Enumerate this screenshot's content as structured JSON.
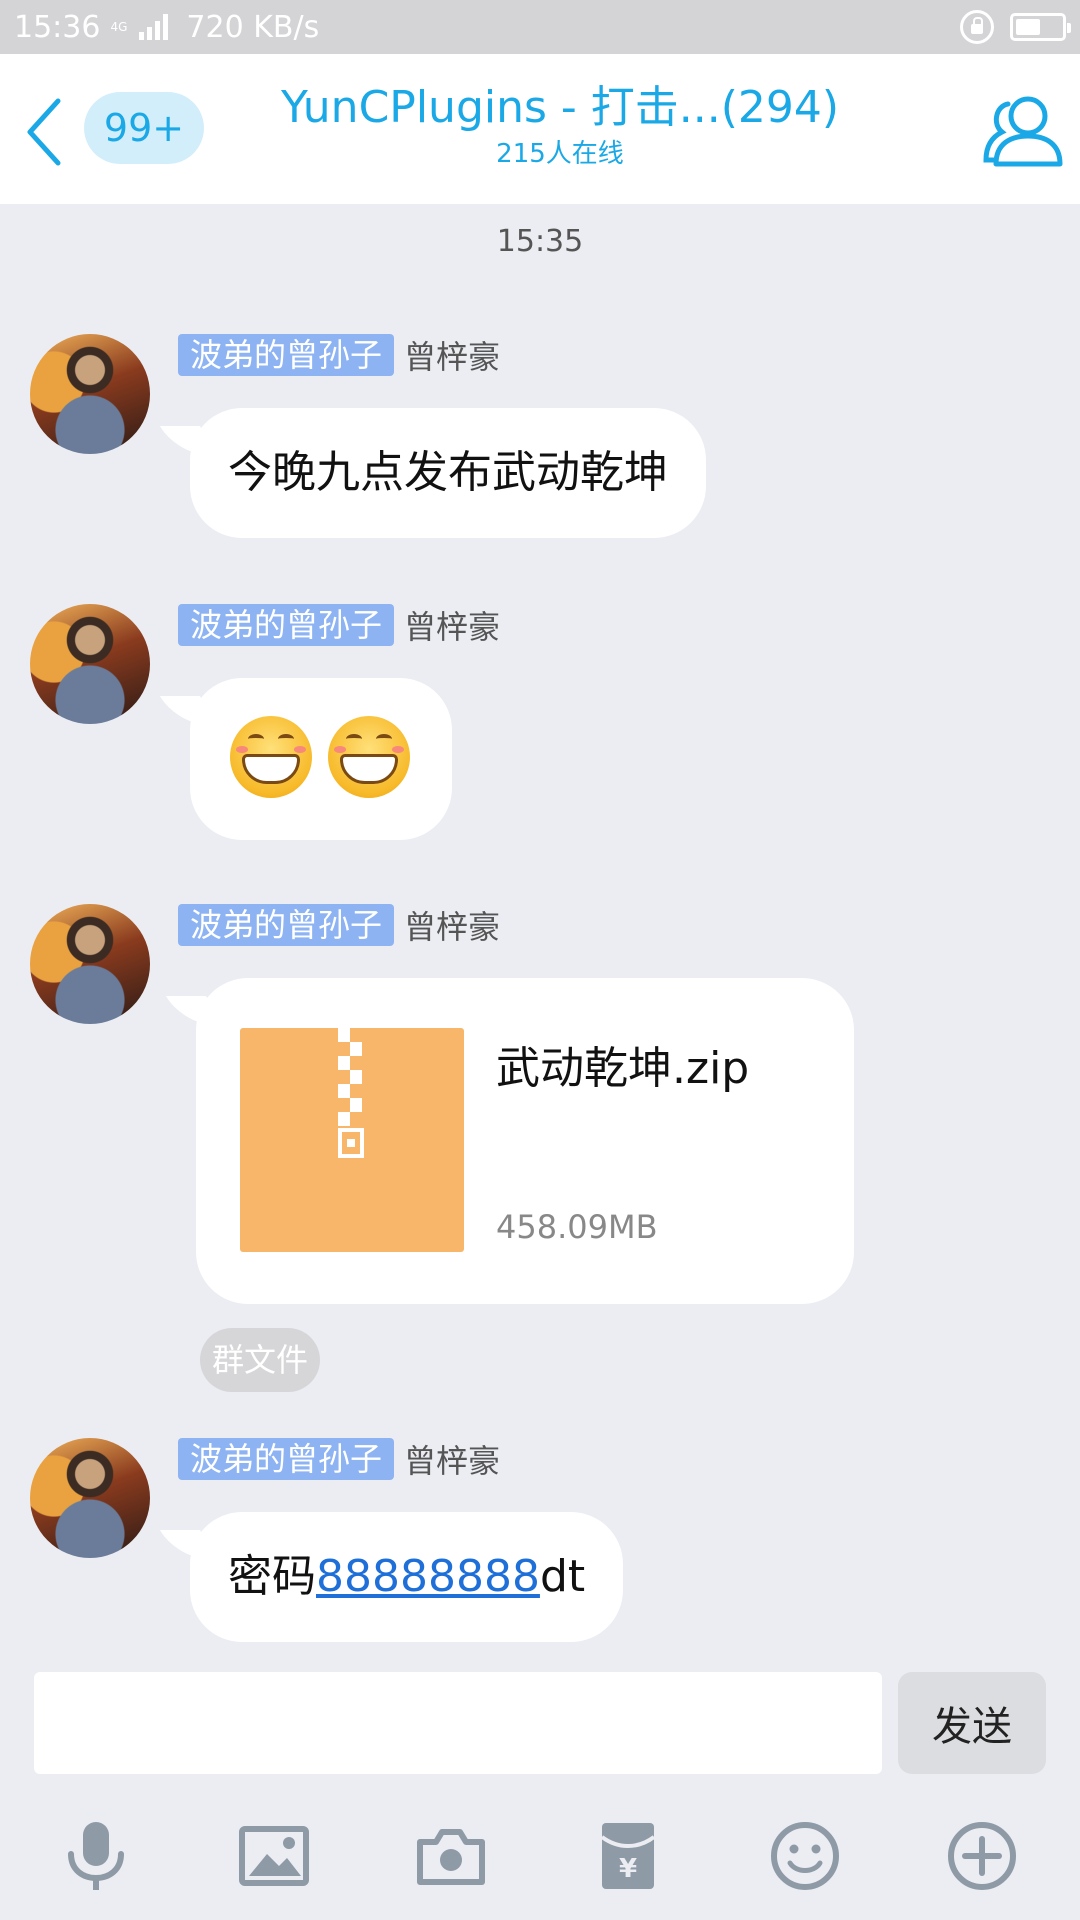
{
  "status_bar": {
    "time": "15:36",
    "network": "4G",
    "speed": "720 KB/s"
  },
  "header": {
    "unread_badge": "99+",
    "title": "YunCPlugins - 打击...(294)",
    "subtitle": "215人在线"
  },
  "chat": {
    "timestamp": "15:35",
    "messages": [
      {
        "rank_tag": "波弟的曾孙子",
        "sender": "曾梓豪",
        "text": "今晚九点发布武动乾坤"
      },
      {
        "rank_tag": "波弟的曾孙子",
        "sender": "曾梓豪",
        "emojis": [
          "grin-emoji",
          "grin-emoji"
        ]
      },
      {
        "rank_tag": "波弟的曾孙子",
        "sender": "曾梓豪",
        "file": {
          "name": "武动乾坤.zip",
          "size": "458.09MB"
        },
        "file_tag": "群文件"
      },
      {
        "rank_tag": "波弟的曾孙子",
        "sender": "曾梓豪",
        "text_prefix": "密码",
        "link": "88888888",
        "text_suffix": "dt"
      }
    ]
  },
  "input": {
    "value": "",
    "placeholder": "",
    "send_label": "发送"
  },
  "toolbar": {
    "icons": [
      "microphone-icon",
      "image-icon",
      "camera-icon",
      "red-packet-icon",
      "emoji-icon",
      "plus-icon"
    ]
  },
  "colors": {
    "accent": "#1aa8e6",
    "rank_tag": "#8db3f3",
    "background": "#ebedf2",
    "link": "#1f6fd8",
    "file_icon": "#f7b66a"
  }
}
